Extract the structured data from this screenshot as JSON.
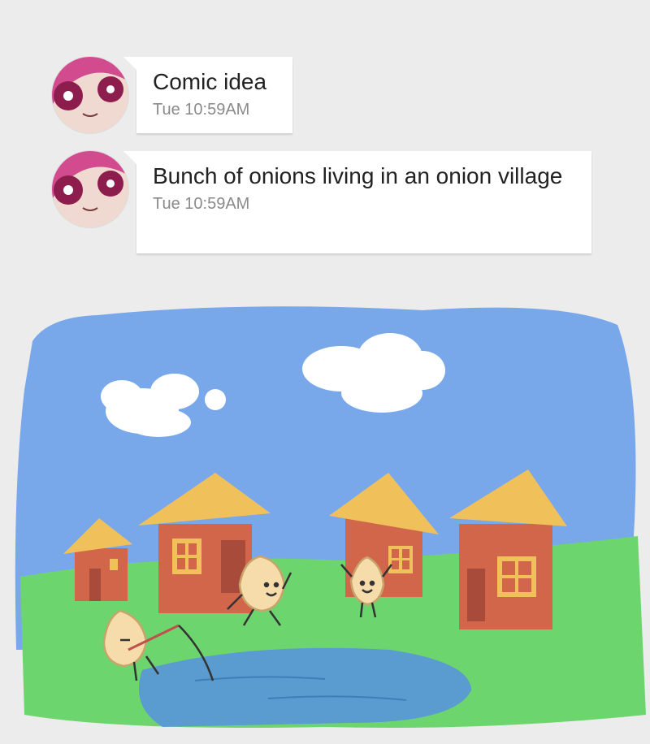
{
  "messages": [
    {
      "text": "Comic idea",
      "time": "Tue 10:59AM"
    },
    {
      "text": "Bunch of onions living in an onion village",
      "time": "Tue 10:59AM"
    }
  ],
  "colors": {
    "sky": "#79a8ea",
    "grass": "#6dd56e",
    "roof": "#f0c05a",
    "wall": "#d2664a",
    "pond": "#5a9ccf",
    "onion": "#f5dcaa"
  }
}
